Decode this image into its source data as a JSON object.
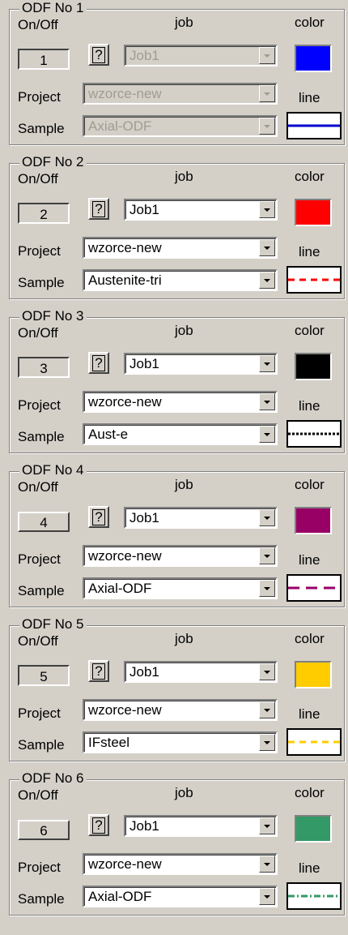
{
  "labels": {
    "on_off": "On/Off",
    "job": "job",
    "color": "color",
    "project": "Project",
    "sample": "Sample",
    "line": "line",
    "help": "?"
  },
  "panels": [
    {
      "title": "ODF No 1",
      "number": "1",
      "job": "Job1",
      "project": "wzorce-new",
      "sample": "Axial-ODF",
      "color": "#0000ff",
      "line_style": "solid",
      "line_color": "#0000cc",
      "enabled": false,
      "icon": "help-icon"
    },
    {
      "title": "ODF No 2",
      "number": "2",
      "job": "Job1",
      "project": "wzorce-new",
      "sample": "Austenite-tri",
      "color": "#ff0000",
      "line_style": "dashed",
      "line_color": "#ff0000",
      "enabled": true,
      "icon": "help-icon"
    },
    {
      "title": "ODF No 3",
      "number": "3",
      "job": "Job1",
      "project": "wzorce-new",
      "sample": "Aust-e",
      "color": "#000000",
      "line_style": "dotted",
      "line_color": "#000000",
      "enabled": true,
      "icon": "help-icon"
    },
    {
      "title": "ODF No 4",
      "number": "4",
      "job": "Job1",
      "project": "wzorce-new",
      "sample": "Axial-ODF",
      "color": "#990066",
      "line_style": "long-dash",
      "line_color": "#990066",
      "enabled": true,
      "icon": "help-icon"
    },
    {
      "title": "ODF No 5",
      "number": "5",
      "job": "Job1",
      "project": "wzorce-new",
      "sample": "IFsteel",
      "color": "#ffcc00",
      "line_style": "dashed",
      "line_color": "#ffcc00",
      "enabled": true,
      "icon": "help-icon"
    },
    {
      "title": "ODF No 6",
      "number": "6",
      "job": "Job1",
      "project": "wzorce-new",
      "sample": "Axial-ODF",
      "color": "#339966",
      "line_style": "dash-dot",
      "line_color": "#339966",
      "enabled": true,
      "icon": "help-icon"
    }
  ]
}
